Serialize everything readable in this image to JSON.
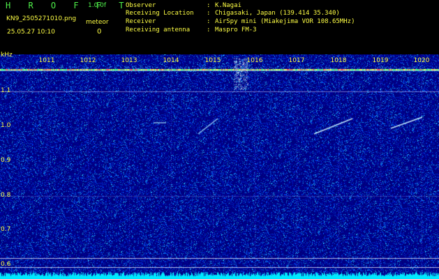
{
  "header": {
    "title": "H R O F F T",
    "version": "1.0.0f",
    "filename": "KN9_2505271010.png",
    "timestamp": "25.05.27 10:10",
    "meteor_label": "meteor",
    "meteor_count": "0",
    "info": [
      {
        "label": "Observer",
        "value": "K.Nagai"
      },
      {
        "label": "Receiving Location",
        "value": "Chigasaki, Japan (139.414 35.340)"
      },
      {
        "label": "Receiver",
        "value": "AirSpy mini (Miakejima VOR 108.65MHz)"
      },
      {
        "label": "Receiving antenna",
        "value": "Maspro FM-3"
      }
    ],
    "separator": ":"
  },
  "axes": {
    "unit": "kHz",
    "x_ticks": [
      "1011",
      "1012",
      "1013",
      "1014",
      "1015",
      "1016",
      "1017",
      "1018",
      "1019",
      "1020"
    ],
    "y_ticks": [
      "1.1",
      "1.0",
      "0.9",
      "0.8",
      "0.7",
      "0.6"
    ]
  },
  "colors": {
    "background": "#00007a",
    "header_text": "#ffff44",
    "title_text": "#4ff04a",
    "noise_band": "#00e8ff"
  }
}
